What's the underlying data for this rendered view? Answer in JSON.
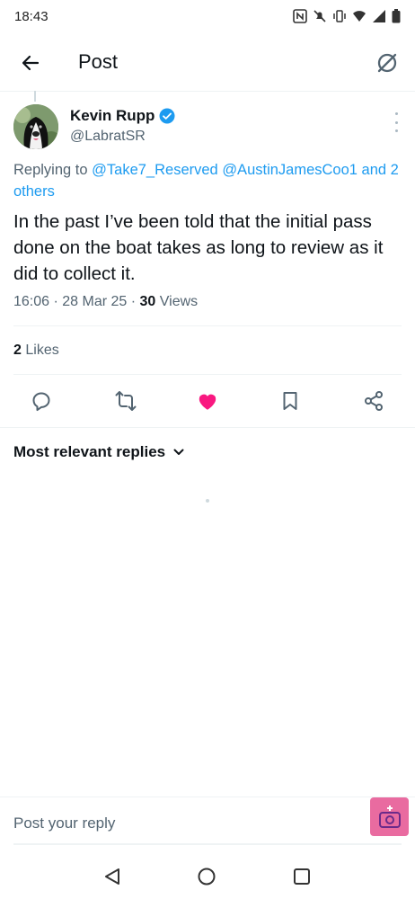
{
  "status_bar": {
    "time": "18:43"
  },
  "header": {
    "title": "Post"
  },
  "author": {
    "name": "Kevin Rupp",
    "handle": "@LabratSR"
  },
  "reply_context": {
    "prefix": "Replying to ",
    "mention_1": "@Take7_Reserved",
    "mention_2": "@AustinJamesCoo1",
    "suffix": " and 2",
    "suffix_line2": "others"
  },
  "tweet": {
    "text": "In the past I’ve been told that the initial pass done on the boat takes as long to review as it did to collect it.",
    "time": "16:06",
    "date": "28 Mar 25",
    "views_count": "30",
    "views_label": "Views",
    "likes_count": "2",
    "likes_label": "Likes"
  },
  "replies": {
    "sort_label": "Most relevant replies"
  },
  "composer": {
    "placeholder": "Post your reply"
  },
  "colors": {
    "accent": "#1d9bf0",
    "like": "#f91880",
    "fab": "#e96ba0"
  }
}
